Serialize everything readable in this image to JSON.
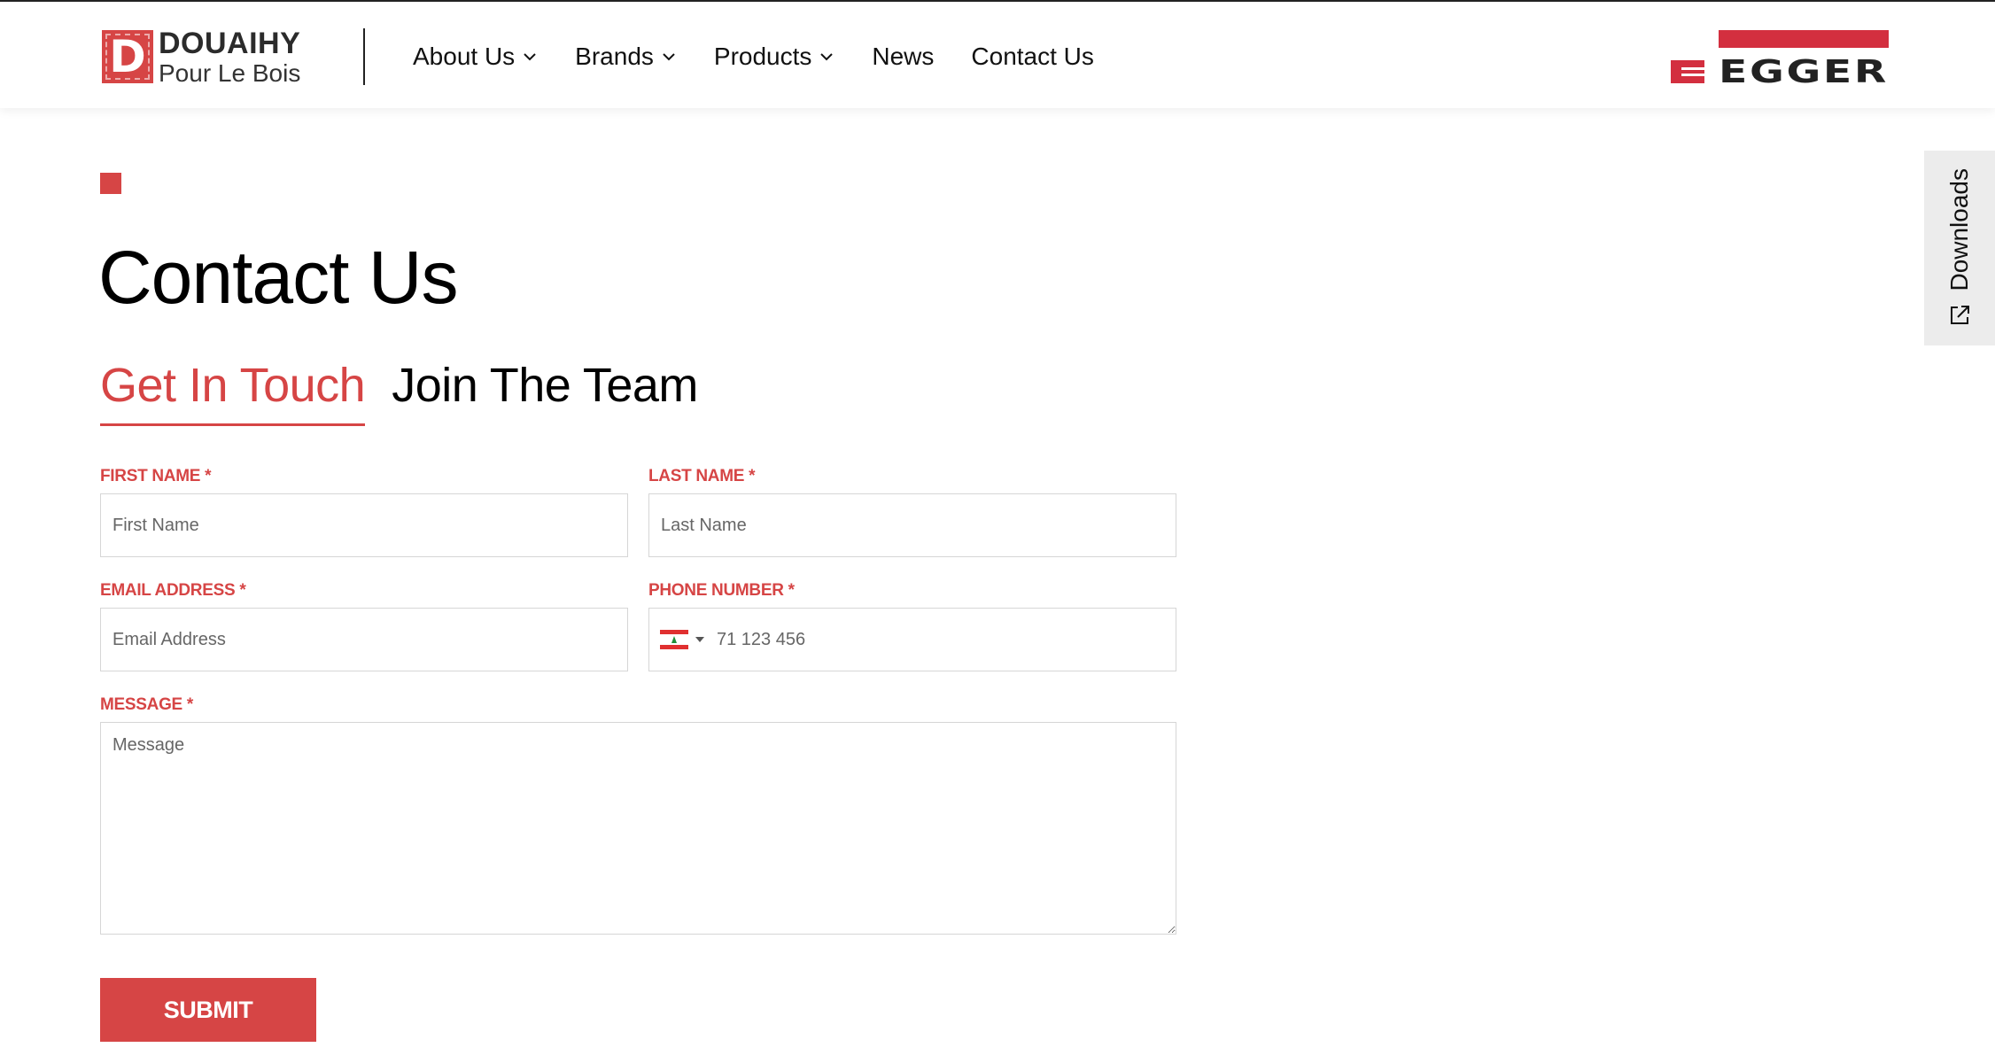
{
  "brand": {
    "logo_letter": "D",
    "name": "DOUAIHY",
    "subtitle": "Pour Le Bois",
    "partner_logo": "EGGER"
  },
  "nav": {
    "items": [
      {
        "label": "About Us",
        "dropdown": true
      },
      {
        "label": "Brands",
        "dropdown": true
      },
      {
        "label": "Products",
        "dropdown": true
      },
      {
        "label": "News",
        "dropdown": false
      },
      {
        "label": "Contact Us",
        "dropdown": false
      }
    ]
  },
  "downloads": {
    "label": "Downloads",
    "icon": "external-link-icon"
  },
  "page": {
    "title": "Contact Us"
  },
  "tabs": [
    {
      "label": "Get In Touch",
      "active": true
    },
    {
      "label": "Join The Team",
      "active": false
    }
  ],
  "form": {
    "first_name": {
      "label": "FIRST NAME *",
      "placeholder": "First Name"
    },
    "last_name": {
      "label": "LAST NAME *",
      "placeholder": "Last Name"
    },
    "email": {
      "label": "EMAIL ADDRESS *",
      "placeholder": "Email Address"
    },
    "phone": {
      "label": "PHONE NUMBER *",
      "placeholder": "71 123 456",
      "country": "lebanon-flag-icon"
    },
    "message": {
      "label": "MESSAGE *",
      "placeholder": "Message"
    },
    "submit_label": "SUBMIT"
  },
  "colors": {
    "accent": "#d64545",
    "text": "#111111",
    "border": "#d6d6d6",
    "tab_bg": "#ececec"
  }
}
